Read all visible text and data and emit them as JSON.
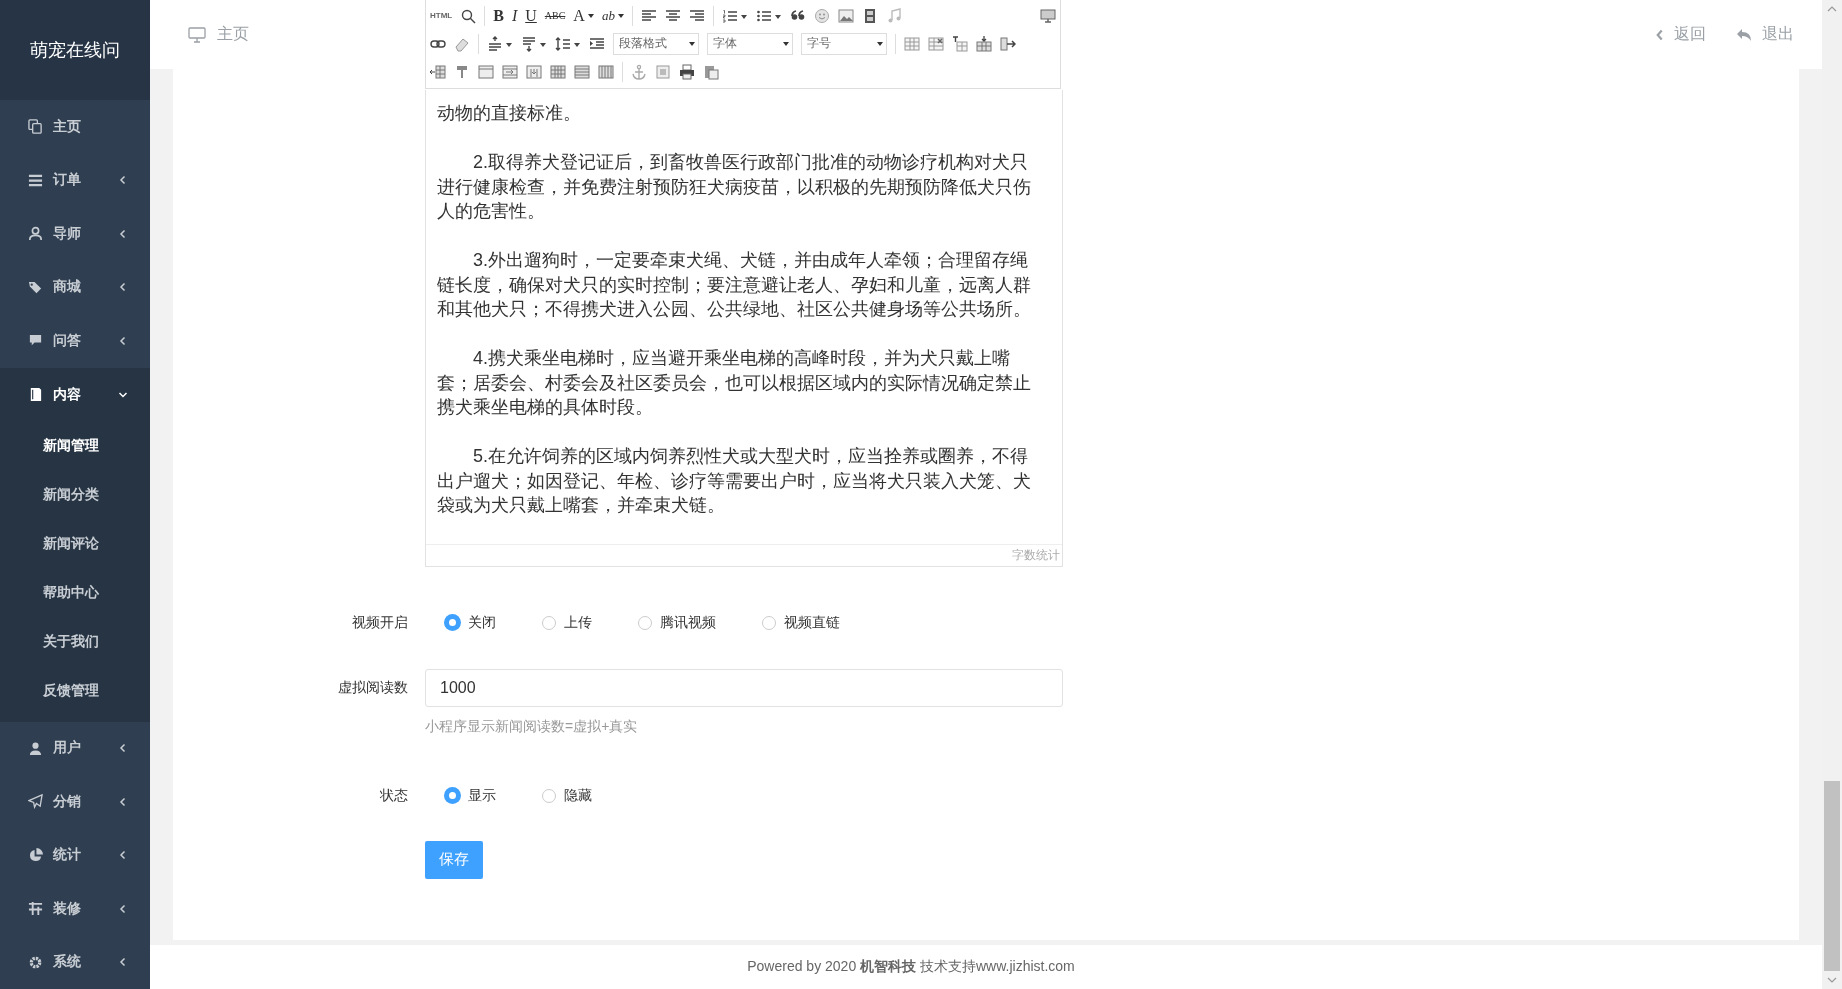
{
  "app": {
    "title": "萌宠在线问"
  },
  "sidebar": {
    "items": [
      {
        "label": "主页",
        "kind": "link"
      },
      {
        "label": "订单",
        "kind": "group",
        "expanded": false
      },
      {
        "label": "导师",
        "kind": "group",
        "expanded": false
      },
      {
        "label": "商城",
        "kind": "group",
        "expanded": false
      },
      {
        "label": "问答",
        "kind": "group",
        "expanded": false
      },
      {
        "label": "内容",
        "kind": "group",
        "expanded": true,
        "children": [
          {
            "label": "新闻管理",
            "selected": true
          },
          {
            "label": "新闻分类",
            "selected": false
          },
          {
            "label": "新闻评论",
            "selected": false
          },
          {
            "label": "帮助中心",
            "selected": false
          },
          {
            "label": "关于我们",
            "selected": false
          },
          {
            "label": "反馈管理",
            "selected": false
          }
        ]
      },
      {
        "label": "用户",
        "kind": "group",
        "expanded": false
      },
      {
        "label": "分销",
        "kind": "group",
        "expanded": false
      },
      {
        "label": "统计",
        "kind": "group",
        "expanded": false
      },
      {
        "label": "装修",
        "kind": "group",
        "expanded": false
      },
      {
        "label": "系统",
        "kind": "group",
        "expanded": false
      }
    ]
  },
  "header": {
    "breadcrumb": "主页",
    "actions": [
      {
        "label": "返回"
      },
      {
        "label": "退出"
      }
    ]
  },
  "editor": {
    "toolbar": {
      "html_label": "HTML",
      "format_glyphs": [
        "B",
        "I",
        "U",
        "ABC",
        "A",
        "ab"
      ],
      "dropdowns": [
        "段落格式",
        "字体",
        "字号"
      ]
    },
    "paragraphs": [
      {
        "text": "动物的直接标准。",
        "indented": false
      },
      {
        "text": "2.取得养犬登记证后，到畜牧兽医行政部门批准的动物诊疗机构对犬只进行健康检查，并免费注射预防狂犬病疫苗，以积极的先期预防降低犬只伤人的危害性。",
        "indented": true
      },
      {
        "text": "3.外出遛狗时，一定要牵束犬绳、犬链，并由成年人牵领；合理留存绳链长度，确保对犬只的实时控制；要注意避让老人、孕妇和儿童，远离人群和其他犬只；不得携犬进入公园、公共绿地、社区公共健身场等公共场所。",
        "indented": true
      },
      {
        "text": "4.携犬乘坐电梯时，应当避开乘坐电梯的高峰时段，并为犬只戴上嘴套；居委会、村委会及社区委员会，也可以根据区域内的实际情况确定禁止携犬乘坐电梯的具体时段。",
        "indented": true
      },
      {
        "text": "5.在允许饲养的区域内饲养烈性犬或大型犬时，应当拴养或圈养，不得出户遛犬；如因登记、年检、诊疗等需要出户时，应当将犬只装入犬笼、犬袋或为犬只戴上嘴套，并牵束犬链。",
        "indented": true
      }
    ],
    "word_count_label": "字数统计"
  },
  "form": {
    "video": {
      "label": "视频开启",
      "options": [
        {
          "label": "关闭",
          "selected": true
        },
        {
          "label": "上传",
          "selected": false
        },
        {
          "label": "腾讯视频",
          "selected": false
        },
        {
          "label": "视频直链",
          "selected": false
        }
      ]
    },
    "virtual_reads": {
      "label": "虚拟阅读数",
      "value": "1000",
      "hint": "小程序显示新闻阅读数=虚拟+真实"
    },
    "status": {
      "label": "状态",
      "options": [
        {
          "label": "显示",
          "selected": true
        },
        {
          "label": "隐藏",
          "selected": false
        }
      ]
    },
    "save_button": "保存"
  },
  "footer": "Powered by 2020 **机智科技** 技术支持www.jizhist.com"
}
